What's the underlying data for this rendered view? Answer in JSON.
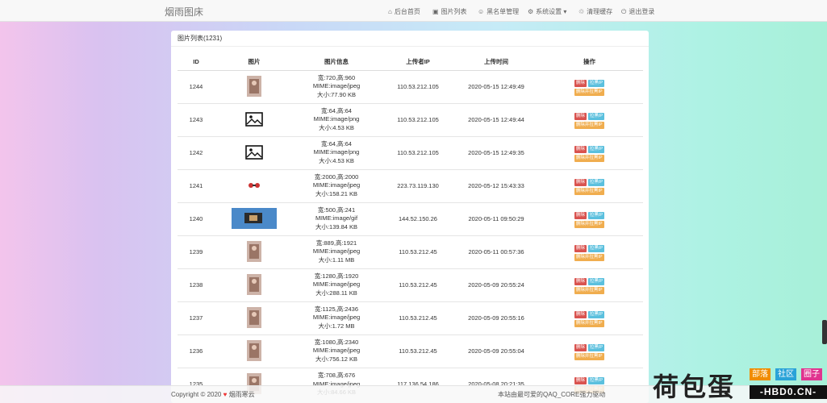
{
  "nav": {
    "brand": "烟雨图床",
    "items": [
      {
        "icon": "home-icon",
        "glyph": "⌂",
        "label": "后台首页"
      },
      {
        "icon": "image-icon",
        "glyph": "▣",
        "label": "图片列表"
      },
      {
        "icon": "user-icon",
        "glyph": "☺",
        "label": "黑名单管理"
      },
      {
        "icon": "gear-icon",
        "glyph": "⚙",
        "label": "系统设置 ▾"
      },
      {
        "icon": "trash-icon",
        "glyph": "♲",
        "label": "清理缓存"
      },
      {
        "icon": "logout-icon",
        "glyph": "⏻",
        "label": "退出登录"
      }
    ]
  },
  "panel": {
    "title": "图片列表(1231)",
    "columns": [
      "ID",
      "图片",
      "图片信息",
      "上传者IP",
      "上传时间",
      "操作"
    ],
    "actions": {
      "delete": "删除",
      "block": "拉黑IP",
      "both": "删除并拉黑IP"
    },
    "rows": [
      {
        "id": "1244",
        "thumb": "photo",
        "size": "宽:720,高:960",
        "mime": "MIME:image/jpeg",
        "filesize": "大小:77.90 KB",
        "ip": "110.53.212.105",
        "time": "2020-05-15 12:49:49"
      },
      {
        "id": "1243",
        "thumb": "placeholder",
        "size": "宽:64,高:64",
        "mime": "MIME:image/png",
        "filesize": "大小:4.53 KB",
        "ip": "110.53.212.105",
        "time": "2020-05-15 12:49:44"
      },
      {
        "id": "1242",
        "thumb": "placeholder",
        "size": "宽:64,高:64",
        "mime": "MIME:image/png",
        "filesize": "大小:4.53 KB",
        "ip": "110.53.212.105",
        "time": "2020-05-15 12:49:35"
      },
      {
        "id": "1241",
        "thumb": "sticker",
        "size": "宽:2000,高:2000",
        "mime": "MIME:image/jpeg",
        "filesize": "大小:158.21 KB",
        "ip": "223.73.119.130",
        "time": "2020-05-12 15:43:33"
      },
      {
        "id": "1240",
        "thumb": "wide",
        "size": "宽:500,高:241",
        "mime": "MIME:image/gif",
        "filesize": "大小:139.84 KB",
        "ip": "144.52.150.26",
        "time": "2020-05-11 09:50:29"
      },
      {
        "id": "1239",
        "thumb": "photo",
        "size": "宽:889,高:1921",
        "mime": "MIME:image/jpeg",
        "filesize": "大小:1.11 MB",
        "ip": "110.53.212.45",
        "time": "2020-05-11 00:57:36"
      },
      {
        "id": "1238",
        "thumb": "photo",
        "size": "宽:1280,高:1920",
        "mime": "MIME:image/jpeg",
        "filesize": "大小:288.11 KB",
        "ip": "110.53.212.45",
        "time": "2020-05-09 20:55:24"
      },
      {
        "id": "1237",
        "thumb": "photo",
        "size": "宽:1125,高:2436",
        "mime": "MIME:image/jpeg",
        "filesize": "大小:1.72 MB",
        "ip": "110.53.212.45",
        "time": "2020-05-09 20:55:16"
      },
      {
        "id": "1236",
        "thumb": "photo",
        "size": "宽:1080,高:2340",
        "mime": "MIME:image/jpeg",
        "filesize": "大小:756.12 KB",
        "ip": "110.53.212.45",
        "time": "2020-05-09 20:55:04"
      },
      {
        "id": "1235",
        "thumb": "photo",
        "size": "宽:708,高:676",
        "mime": "MIME:image/jpeg",
        "filesize": "大小:84.66 KB",
        "ip": "117.136.54.186",
        "time": "2020-05-08 20:21:35"
      }
    ]
  },
  "footer": {
    "copyright": "Copyright © 2020",
    "heart": "♥",
    "owner": "烟雨寒云",
    "powered": "本站由最可爱的QAQ_CORE强力驱动"
  },
  "watermark": {
    "main": "荷包蛋",
    "tags": [
      "部落",
      "社区",
      "圈子"
    ],
    "tag_colors": [
      "#f08c00",
      "#2aa3d8",
      "#e0338f"
    ],
    "sub": "-HBD0.CN-"
  }
}
